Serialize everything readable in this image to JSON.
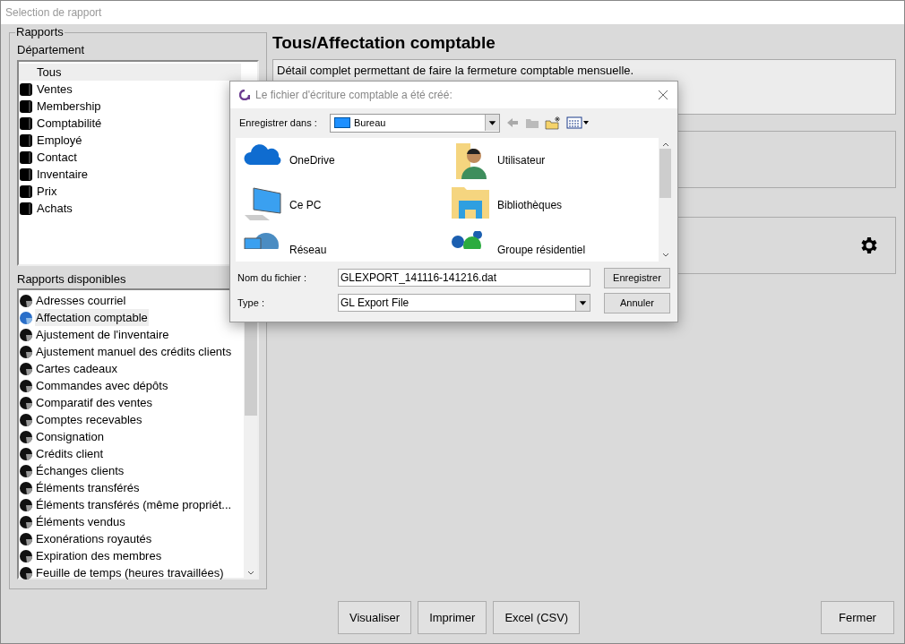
{
  "window": {
    "title": "Selection de rapport"
  },
  "reports_group": {
    "title": "Rapports",
    "department_label": "Département",
    "available_label": "Rapports disponibles"
  },
  "departments": [
    {
      "label": "Tous",
      "kind": "all",
      "selected": true
    },
    {
      "label": "Ventes",
      "kind": "department",
      "selected": false
    },
    {
      "label": "Membership",
      "kind": "department",
      "selected": false
    },
    {
      "label": "Comptabilité",
      "kind": "department",
      "selected": false
    },
    {
      "label": "Employé",
      "kind": "department",
      "selected": false
    },
    {
      "label": "Contact",
      "kind": "department",
      "selected": false
    },
    {
      "label": "Inventaire",
      "kind": "department",
      "selected": false
    },
    {
      "label": "Prix",
      "kind": "department",
      "selected": false
    },
    {
      "label": "Achats",
      "kind": "department",
      "selected": false
    }
  ],
  "reports": [
    {
      "label": "Adresses courriel",
      "selected": false
    },
    {
      "label": "Affectation comptable",
      "selected": true
    },
    {
      "label": "Ajustement de l'inventaire",
      "selected": false
    },
    {
      "label": "Ajustement manuel des crédits clients",
      "selected": false
    },
    {
      "label": "Cartes cadeaux",
      "selected": false
    },
    {
      "label": "Commandes avec dépôts",
      "selected": false
    },
    {
      "label": "Comparatif des ventes",
      "selected": false
    },
    {
      "label": "Comptes recevables",
      "selected": false
    },
    {
      "label": "Consignation",
      "selected": false
    },
    {
      "label": "Crédits client",
      "selected": false
    },
    {
      "label": "Échanges clients",
      "selected": false
    },
    {
      "label": "Éléments transférés",
      "selected": false
    },
    {
      "label": "Éléments transférés (même propriét...",
      "selected": false
    },
    {
      "label": "Éléments vendus",
      "selected": false
    },
    {
      "label": "Exonérations royautés",
      "selected": false
    },
    {
      "label": "Expiration des membres",
      "selected": false
    },
    {
      "label": "Feuille de temps (heures travaillées)",
      "selected": false
    }
  ],
  "report_title": "Tous/Affectation comptable",
  "report_description": "Détail complet permettant de faire la fermeture comptable mensuelle.",
  "dialog": {
    "title": "Le fichier d'écriture comptable a été créé:",
    "save_in_label": "Enregistrer dans :",
    "save_in_value": "Bureau",
    "places": [
      {
        "label": "OneDrive",
        "kind": "cloud"
      },
      {
        "label": "Utilisateur",
        "kind": "user"
      },
      {
        "label": "Ce PC",
        "kind": "pc"
      },
      {
        "label": "Bibliothèques",
        "kind": "library"
      },
      {
        "label": "Réseau",
        "kind": "network"
      },
      {
        "label": "Groupe résidentiel",
        "kind": "homegroup"
      }
    ],
    "filename_label": "Nom du fichier :",
    "filename_value": "GLEXPORT_141116-141216.dat",
    "type_label": "Type :",
    "type_value": "GL Export File",
    "save_button": "Enregistrer",
    "cancel_button": "Annuler"
  },
  "buttons": [
    "Visualiser",
    "Imprimer",
    "Excel (CSV)"
  ],
  "close_button": "Fermer"
}
